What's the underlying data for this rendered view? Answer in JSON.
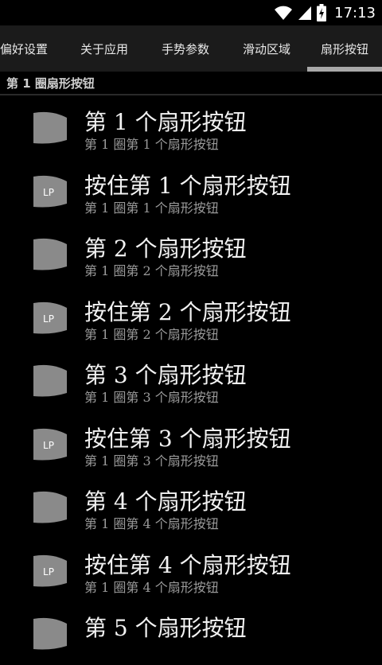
{
  "status_bar": {
    "time": "17:13",
    "icons": [
      "wifi-icon",
      "signal-icon",
      "battery-charging-icon"
    ]
  },
  "tabs": [
    {
      "label": "偏好设置"
    },
    {
      "label": "关于应用"
    },
    {
      "label": "手势参数"
    },
    {
      "label": "滑动区域"
    },
    {
      "label": "扇形按钮",
      "selected": true
    }
  ],
  "section": {
    "title": "第 1 圈扇形按钮"
  },
  "list": {
    "items": [
      {
        "title": "第 1 个扇形按钮",
        "subtitle": "第 1 圈第 1 个扇形按钮",
        "icon_label": ""
      },
      {
        "title": "按住第 1 个扇形按钮",
        "subtitle": "第 1 圈第 1 个扇形按钮",
        "icon_label": "LP"
      },
      {
        "title": "第 2 个扇形按钮",
        "subtitle": "第 1 圈第 2 个扇形按钮",
        "icon_label": ""
      },
      {
        "title": "按住第 2 个扇形按钮",
        "subtitle": "第 1 圈第 2 个扇形按钮",
        "icon_label": "LP"
      },
      {
        "title": "第 3 个扇形按钮",
        "subtitle": "第 1 圈第 3 个扇形按钮",
        "icon_label": ""
      },
      {
        "title": "按住第 3 个扇形按钮",
        "subtitle": "第 1 圈第 3 个扇形按钮",
        "icon_label": "LP"
      },
      {
        "title": "第 4 个扇形按钮",
        "subtitle": "第 1 圈第 4 个扇形按钮",
        "icon_label": ""
      },
      {
        "title": "按住第 4 个扇形按钮",
        "subtitle": "第 1 圈第 4 个扇形按钮",
        "icon_label": "LP"
      },
      {
        "title": "第 5 个扇形按钮",
        "subtitle": "",
        "icon_label": ""
      }
    ]
  },
  "colors": {
    "background": "#000000",
    "tab_bar": "#1b1b1b",
    "tab_indicator": "#a8a8a8",
    "icon_fill": "#8a8a8a",
    "title": "#f2f2f2",
    "subtitle": "#9a9a9a"
  }
}
